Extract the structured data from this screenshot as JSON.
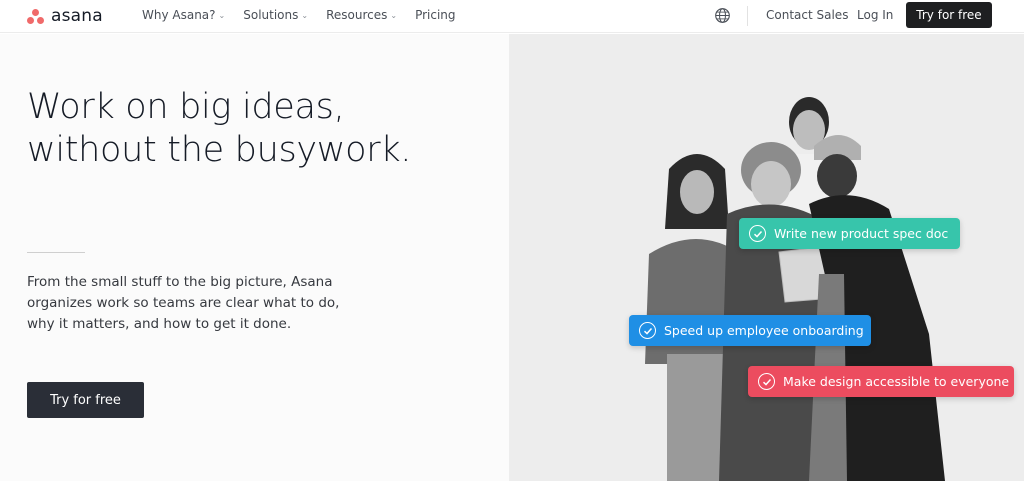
{
  "brand": {
    "name": "asana",
    "accent": "#f06a6a"
  },
  "nav": {
    "items": [
      {
        "label": "Why Asana?",
        "has_dropdown": true
      },
      {
        "label": "Solutions",
        "has_dropdown": true
      },
      {
        "label": "Resources",
        "has_dropdown": true
      },
      {
        "label": "Pricing",
        "has_dropdown": false
      }
    ],
    "globe_icon": "globe-icon",
    "contact_label": "Contact Sales",
    "login_label": "Log In",
    "cta_label": "Try for free"
  },
  "hero": {
    "headline_lines": [
      "Work on big ideas,",
      "without the busywork."
    ],
    "sub_lines": [
      "From the small stuff to the big picture, Asana",
      "organizes work so teams are clear what to do,",
      "why it matters, and how to get it done."
    ],
    "cta_label": "Try for free"
  },
  "tasks": [
    {
      "label": "Write new product spec doc",
      "color": "#37c5ab"
    },
    {
      "label": "Speed up employee onboarding",
      "color": "#1f8fe5"
    },
    {
      "label": "Make design accessible to everyone",
      "color": "#ec4c5f"
    }
  ]
}
